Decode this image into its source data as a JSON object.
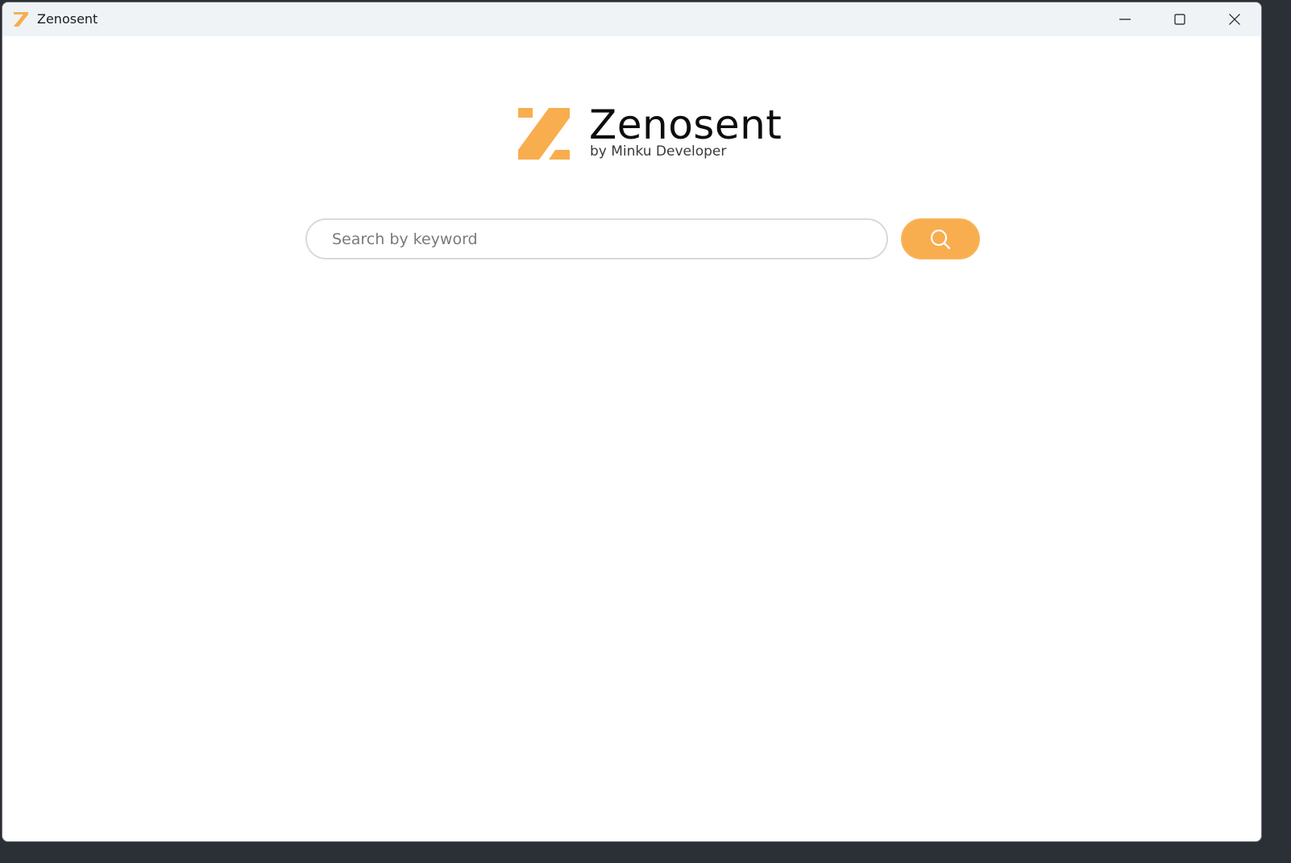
{
  "window": {
    "title": "Zenosent",
    "controls": {
      "minimize_icon": "minimize-icon",
      "maximize_icon": "maximize-icon",
      "close_icon": "close-icon"
    }
  },
  "brand": {
    "name": "Zenosent",
    "subtitle": "by Minku Developer",
    "accent_color": "#f8ad4e"
  },
  "search": {
    "placeholder": "Search by keyword",
    "value": "",
    "button_icon": "search-icon"
  }
}
